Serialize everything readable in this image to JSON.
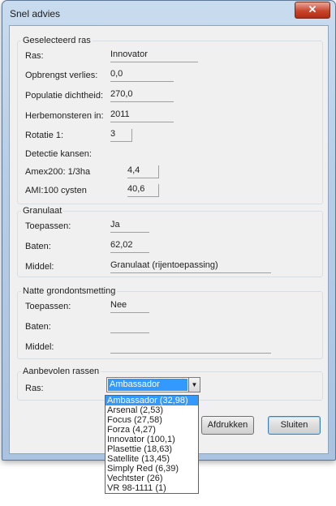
{
  "window": {
    "title": "Snel advies",
    "close_glyph": "✕"
  },
  "geselecteerd": {
    "title": "Geselecteerd ras",
    "rows": [
      {
        "label": "Ras:",
        "value": "Innovator"
      },
      {
        "label": "Opbrengst verlies:",
        "value": "0,0"
      },
      {
        "label": "Populatie dichtheid:",
        "value": "270,0"
      },
      {
        "label": "Herbemonsteren in:",
        "value": "2011"
      },
      {
        "label": "Rotatie 1:",
        "value": "3"
      }
    ],
    "detectie_label": "Detectie kansen:",
    "amex_label": "Amex200: 1/3ha",
    "amex_value": "4,4",
    "ami_label": "AMI:100 cysten",
    "ami_value": "40,6"
  },
  "granulaat": {
    "title": "Granulaat",
    "rows": [
      {
        "label": "Toepassen:",
        "value": "Ja"
      },
      {
        "label": "Baten:",
        "value": "62,02"
      },
      {
        "label": "Middel:",
        "value": "Granulaat (rijentoepassing)"
      }
    ]
  },
  "natte": {
    "title": "Natte grondontsmetting",
    "rows": [
      {
        "label": "Toepassen:",
        "value": "Nee"
      },
      {
        "label": "Baten:",
        "value": ""
      },
      {
        "label": "Middel:",
        "value": ""
      }
    ]
  },
  "aanbevolen": {
    "title": "Aanbevolen rassen",
    "ras_label": "Ras:",
    "selected": "Ambassador",
    "options": [
      "Ambassador (32,98)",
      "Arsenal (2,53)",
      "Focus (27,58)",
      "Forza (4,27)",
      "Innovator (100,1)",
      "Plasettie (18,63)",
      "Satellite (13,45)",
      "Simply Red (6,39)",
      "Vechtster (26)",
      "VR 98-1111 (1)"
    ]
  },
  "buttons": {
    "afdrukken": "Afdrukken",
    "sluiten": "Sluiten"
  }
}
